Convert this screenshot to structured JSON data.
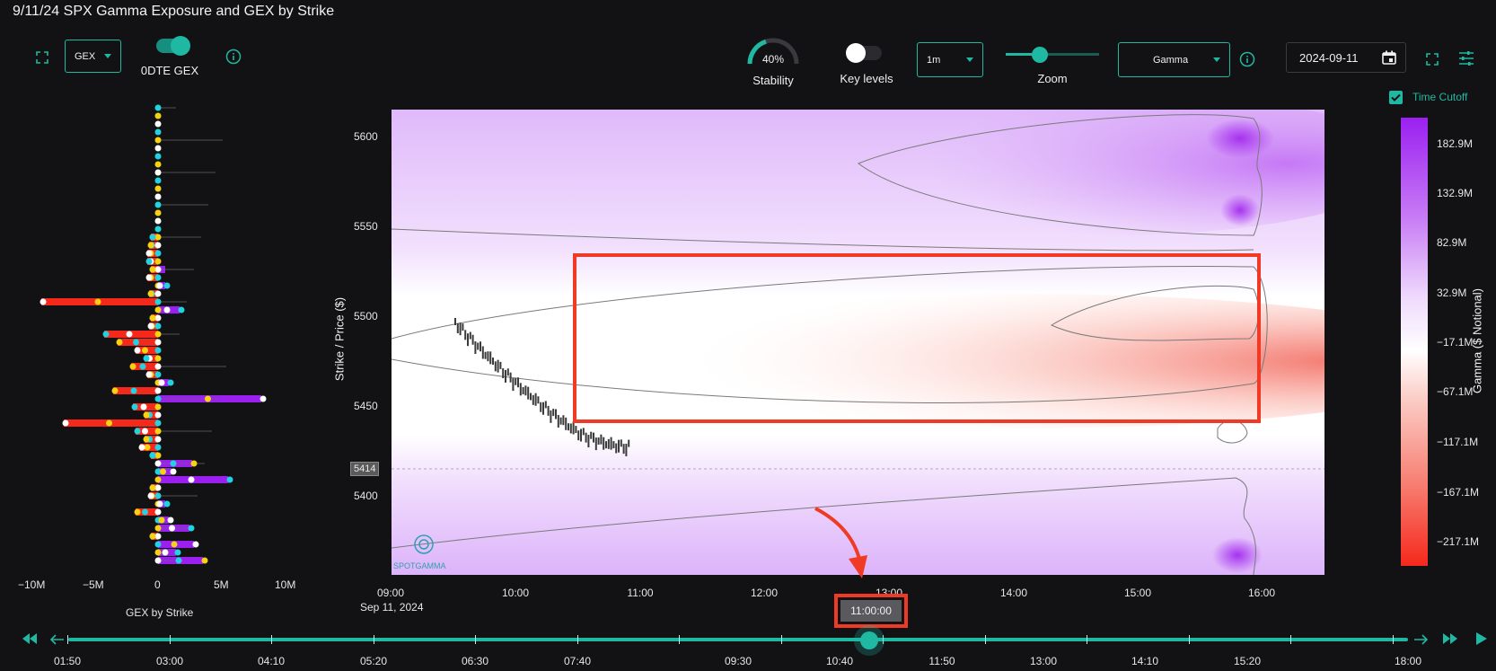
{
  "title": "9/11/24 SPX Gamma Exposure and GEX by Strike",
  "toolbar": {
    "gex_select": "GEX",
    "odte_label": "0DTE GEX",
    "stability_value": "40%",
    "stability_fraction": 0.4,
    "stability_label": "Stability",
    "key_levels_label": "Key levels",
    "interval_select": "1m",
    "zoom_label": "Zoom",
    "gamma_select": "Gamma",
    "date_value": "2024-09-11",
    "time_cutoff_label": "Time Cutoff"
  },
  "colors": {
    "accent": "#1fb8a2",
    "purple": "#9b20f0",
    "red": "#f5281c",
    "yellow": "#f5d30f",
    "cyan": "#1fd3e0",
    "annotation": "#f03a25"
  },
  "gex_chart": {
    "x_ticks": [
      "−10M",
      "−5M",
      "0",
      "5M",
      "10M"
    ],
    "caption": "GEX by Strike"
  },
  "heatmap": {
    "y_label": "Strike / Price ($)",
    "y_ticks": [
      "5600",
      "5550",
      "5500",
      "5450",
      "5400"
    ],
    "x_ticks": [
      "09:00",
      "10:00",
      "11:00",
      "12:00",
      "13:00",
      "14:00",
      "15:00",
      "16:00"
    ],
    "x_sub": "Sep 11, 2024",
    "price_marker": "5414",
    "watermark": "SPOTGAMMA"
  },
  "colorbar": {
    "title": "Gamma ($ Notional)",
    "ticks": [
      "182.9M",
      "132.9M",
      "82.9M",
      "32.9M",
      "−17.1M",
      "−67.1M",
      "−117.1M",
      "−167.1M",
      "−217.1M"
    ]
  },
  "timeline": {
    "current": "11:00:00",
    "labels": [
      "01:50",
      "03:00",
      "04:10",
      "05:20",
      "06:30",
      "07:40",
      "09:30",
      "10:40",
      "11:50",
      "13:00",
      "14:10",
      "15:20",
      "18:00"
    ]
  }
}
